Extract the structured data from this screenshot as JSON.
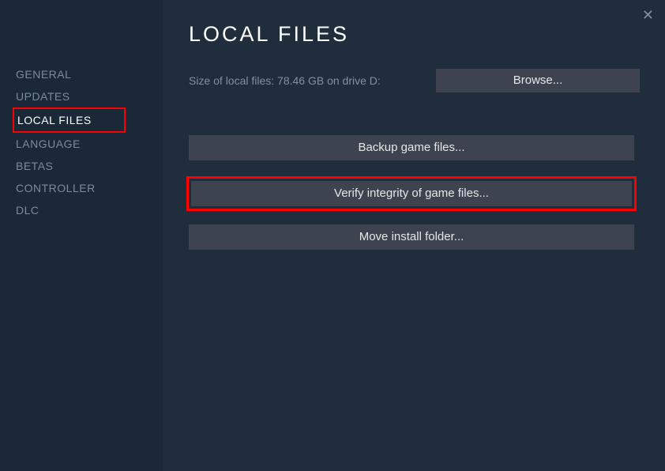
{
  "sidebar": {
    "items": [
      {
        "label": "GENERAL"
      },
      {
        "label": "UPDATES"
      },
      {
        "label": "LOCAL FILES"
      },
      {
        "label": "LANGUAGE"
      },
      {
        "label": "BETAS"
      },
      {
        "label": "CONTROLLER"
      },
      {
        "label": "DLC"
      }
    ]
  },
  "page": {
    "title": "LOCAL FILES",
    "size_text": "Size of local files: 78.46 GB on drive D:",
    "browse_label": "Browse...",
    "backup_label": "Backup game files...",
    "verify_label": "Verify integrity of game files...",
    "move_label": "Move install folder..."
  }
}
